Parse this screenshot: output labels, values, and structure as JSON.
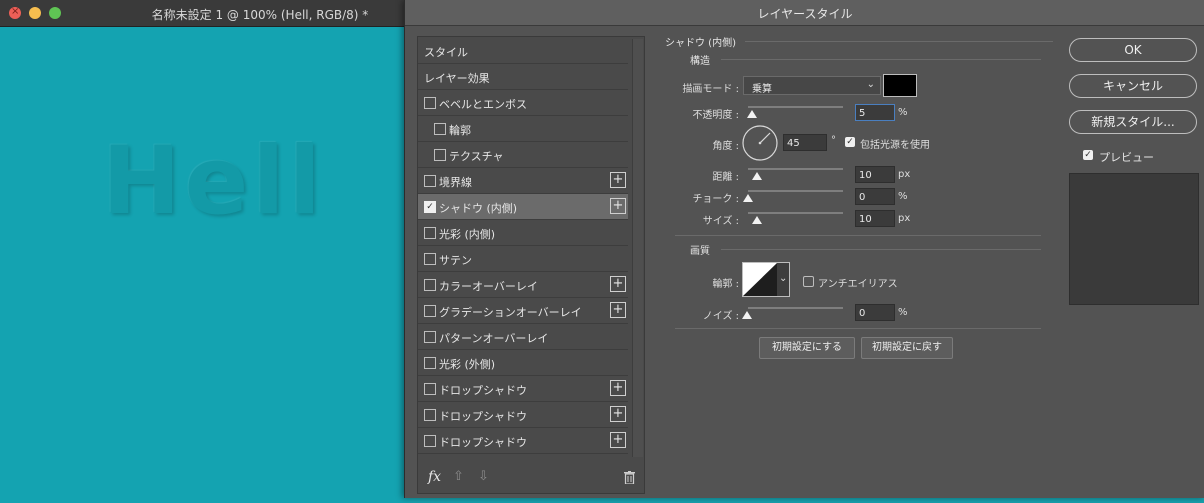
{
  "document_window": {
    "title": "名称未設定 1 @ 100% (Hell, RGB/8) *",
    "canvas_text": "Hell",
    "canvas_color": "#14a3b1"
  },
  "dialog": {
    "title": "レイヤースタイル",
    "styles_list": {
      "items": [
        {
          "label": "スタイル",
          "checkbox": false,
          "checked": false,
          "indent": 0,
          "plus": false,
          "selected": false
        },
        {
          "label": "レイヤー効果",
          "checkbox": false,
          "checked": false,
          "indent": 0,
          "plus": false,
          "selected": false
        },
        {
          "label": "ベベルとエンボス",
          "checkbox": true,
          "checked": false,
          "indent": 0,
          "plus": false,
          "selected": false
        },
        {
          "label": "輪郭",
          "checkbox": true,
          "checked": false,
          "indent": 1,
          "plus": false,
          "selected": false
        },
        {
          "label": "テクスチャ",
          "checkbox": true,
          "checked": false,
          "indent": 1,
          "plus": false,
          "selected": false
        },
        {
          "label": "境界線",
          "checkbox": true,
          "checked": false,
          "indent": 0,
          "plus": true,
          "selected": false
        },
        {
          "label": "シャドウ (内側)",
          "checkbox": true,
          "checked": true,
          "indent": 0,
          "plus": true,
          "selected": true
        },
        {
          "label": "光彩 (内側)",
          "checkbox": true,
          "checked": false,
          "indent": 0,
          "plus": false,
          "selected": false
        },
        {
          "label": "サテン",
          "checkbox": true,
          "checked": false,
          "indent": 0,
          "plus": false,
          "selected": false
        },
        {
          "label": "カラーオーバーレイ",
          "checkbox": true,
          "checked": false,
          "indent": 0,
          "plus": true,
          "selected": false
        },
        {
          "label": "グラデーションオーバーレイ",
          "checkbox": true,
          "checked": false,
          "indent": 0,
          "plus": true,
          "selected": false
        },
        {
          "label": "パターンオーバーレイ",
          "checkbox": true,
          "checked": false,
          "indent": 0,
          "plus": false,
          "selected": false
        },
        {
          "label": "光彩 (外側)",
          "checkbox": true,
          "checked": false,
          "indent": 0,
          "plus": false,
          "selected": false
        },
        {
          "label": "ドロップシャドウ",
          "checkbox": true,
          "checked": false,
          "indent": 0,
          "plus": true,
          "selected": false
        },
        {
          "label": "ドロップシャドウ",
          "checkbox": true,
          "checked": false,
          "indent": 0,
          "plus": true,
          "selected": false
        },
        {
          "label": "ドロップシャドウ",
          "checkbox": true,
          "checked": false,
          "indent": 0,
          "plus": true,
          "selected": false
        }
      ],
      "footer": {
        "fx_label": "fx",
        "up_icon": "arrow-up-icon",
        "down_icon": "arrow-down-icon",
        "trash_icon": "trash-icon"
      }
    },
    "inner_shadow": {
      "section_title": "シャドウ (内側)",
      "structure": {
        "group_title": "構造",
        "blend_mode_label": "描画モード :",
        "blend_mode_value": "乗算",
        "shadow_color": "#000000",
        "opacity_label": "不透明度 :",
        "opacity_value": "5",
        "opacity_unit": "%",
        "angle_label": "角度 :",
        "angle_value": "45",
        "angle_unit": "°",
        "global_light_label": "包括光源を使用",
        "global_light_checked": true,
        "distance_label": "距離 :",
        "distance_value": "10",
        "distance_unit": "px",
        "choke_label": "チョーク :",
        "choke_value": "0",
        "choke_unit": "%",
        "size_label": "サイズ :",
        "size_value": "10",
        "size_unit": "px"
      },
      "quality": {
        "group_title": "画質",
        "contour_label": "輪郭 :",
        "antialias_label": "アンチエイリアス",
        "antialias_checked": false,
        "noise_label": "ノイズ :",
        "noise_value": "0",
        "noise_unit": "%"
      },
      "make_default_label": "初期設定にする",
      "reset_default_label": "初期設定に戻す"
    },
    "buttons": {
      "ok": "OK",
      "cancel": "キャンセル",
      "new_style": "新規スタイル...",
      "preview_label": "プレビュー",
      "preview_checked": true
    }
  }
}
